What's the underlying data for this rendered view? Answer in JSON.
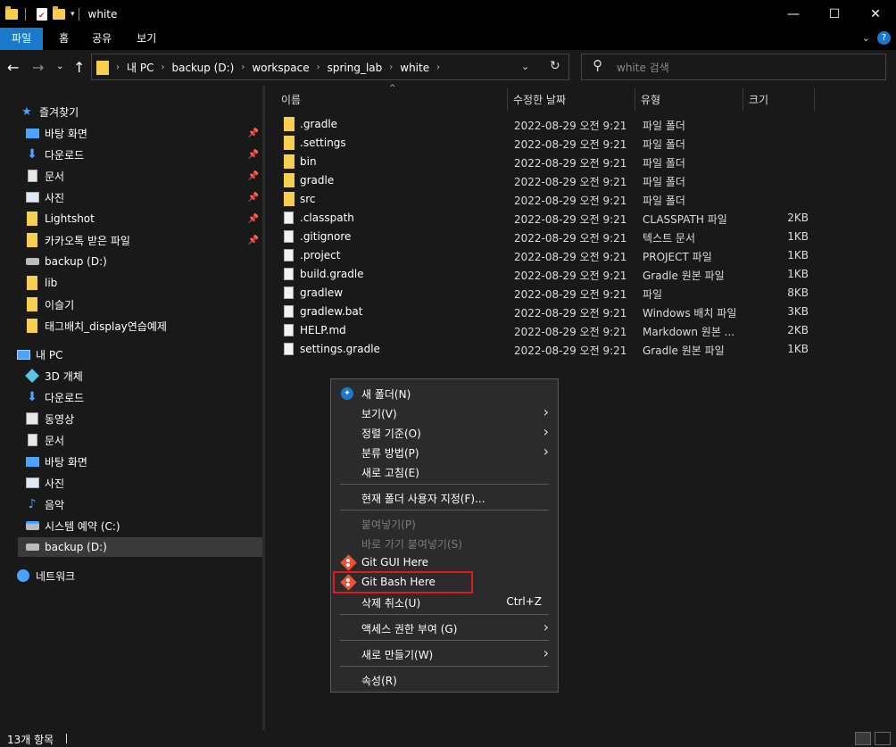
{
  "window": {
    "title": "white",
    "minimize_glyph": "—",
    "maximize_glyph": "☐",
    "close_glyph": "✕"
  },
  "ribbon": {
    "tabs": [
      "파일",
      "홈",
      "공유",
      "보기"
    ]
  },
  "address": {
    "crumbs": [
      "내 PC",
      "backup (D:)",
      "workspace",
      "spring_lab",
      "white"
    ]
  },
  "search": {
    "placeholder": "white 검색"
  },
  "sidebar": {
    "quick_access": "즐겨찾기",
    "quick_items": [
      "바탕 화면",
      "다운로드",
      "문서",
      "사진",
      "Lightshot",
      "카카오톡 받은 파일",
      "backup (D:)",
      "lib",
      "이슬기",
      "태그배치_display연습예제"
    ],
    "this_pc": "내 PC",
    "pc_items": [
      "3D 개체",
      "다운로드",
      "동영상",
      "문서",
      "바탕 화면",
      "사진",
      "음악",
      "시스템 예약 (C:)",
      "backup (D:)"
    ],
    "network": "네트워크"
  },
  "columns": {
    "name": "이름",
    "date": "수정한 날짜",
    "type": "유형",
    "size": "크기"
  },
  "files": [
    {
      "name": ".gradle",
      "date": "2022-08-29 오전 9:21",
      "type": "파일 폴더",
      "size": ""
    },
    {
      "name": ".settings",
      "date": "2022-08-29 오전 9:21",
      "type": "파일 폴더",
      "size": ""
    },
    {
      "name": "bin",
      "date": "2022-08-29 오전 9:21",
      "type": "파일 폴더",
      "size": ""
    },
    {
      "name": "gradle",
      "date": "2022-08-29 오전 9:21",
      "type": "파일 폴더",
      "size": ""
    },
    {
      "name": "src",
      "date": "2022-08-29 오전 9:21",
      "type": "파일 폴더",
      "size": ""
    },
    {
      "name": ".classpath",
      "date": "2022-08-29 오전 9:21",
      "type": "CLASSPATH 파일",
      "size": "2KB"
    },
    {
      "name": ".gitignore",
      "date": "2022-08-29 오전 9:21",
      "type": "텍스트 문서",
      "size": "1KB"
    },
    {
      "name": ".project",
      "date": "2022-08-29 오전 9:21",
      "type": "PROJECT 파일",
      "size": "1KB"
    },
    {
      "name": "build.gradle",
      "date": "2022-08-29 오전 9:21",
      "type": "Gradle 원본 파일",
      "size": "1KB"
    },
    {
      "name": "gradlew",
      "date": "2022-08-29 오전 9:21",
      "type": "파일",
      "size": "8KB"
    },
    {
      "name": "gradlew.bat",
      "date": "2022-08-29 오전 9:21",
      "type": "Windows 배치 파일",
      "size": "3KB"
    },
    {
      "name": "HELP.md",
      "date": "2022-08-29 오전 9:21",
      "type": "Markdown 원본 ...",
      "size": "2KB"
    },
    {
      "name": "settings.gradle",
      "date": "2022-08-29 오전 9:21",
      "type": "Gradle 원본 파일",
      "size": "1KB"
    }
  ],
  "context_menu": {
    "new_folder": "새 폴더(N)",
    "view": "보기(V)",
    "sort_by": "정렬 기준(O)",
    "group_by": "분류 방법(P)",
    "refresh": "새로 고침(E)",
    "customize": "현재 폴더 사용자 지정(F)...",
    "paste": "붙여넣기(P)",
    "paste_shortcut": "바로 가기 붙여넣기(S)",
    "git_gui": "Git GUI Here",
    "git_bash": "Git Bash Here",
    "undo_delete": "삭제 취소(U)",
    "undo_shortcut": "Ctrl+Z",
    "give_access": "액세스 권한 부여 (G)",
    "new": "새로 만들기(W)",
    "properties": "속성(R)"
  },
  "status": {
    "item_count": "13개 항목"
  },
  "colors": {
    "accent": "#1979ca",
    "highlight_box": "#e0191d",
    "folder": "#f7ce4f"
  }
}
